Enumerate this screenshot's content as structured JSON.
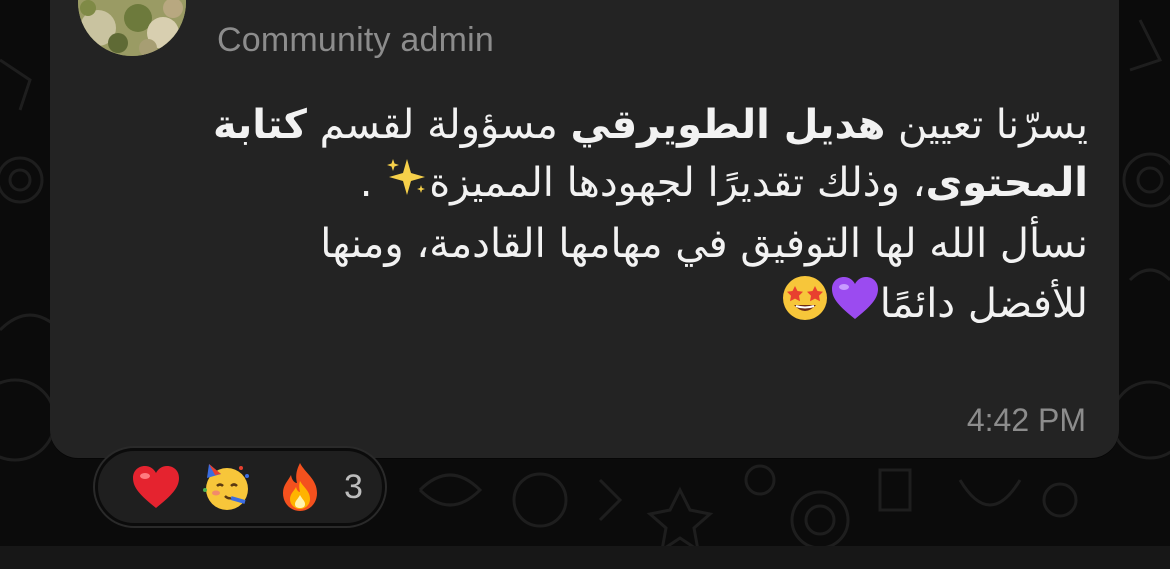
{
  "sender": {
    "role": "Community admin"
  },
  "message": {
    "line1_pre": "يسرّنا تعيين ",
    "line1_bold": "هديل الطويرقي",
    "line1_mid": " مسؤولة لقسم ",
    "line1_bold2": "كتابة",
    "line2_bold": "المحتوى",
    "line2_rest": "، وذلك تقديرًا لجهودها المميزة",
    "line2_end": " .",
    "line3": "نسأل الله لها التوفيق في مهامها القادمة، ومنها",
    "line4": "للأفضل دائمًا",
    "timestamp": "4:42 PM"
  },
  "reactions": {
    "items": [
      "heart",
      "partying-face",
      "fire"
    ],
    "count": "3"
  },
  "colors": {
    "bubble": "#232323",
    "background": "#0b0b0b",
    "text": "#f2f2f2",
    "muted": "#8c8c8c"
  }
}
